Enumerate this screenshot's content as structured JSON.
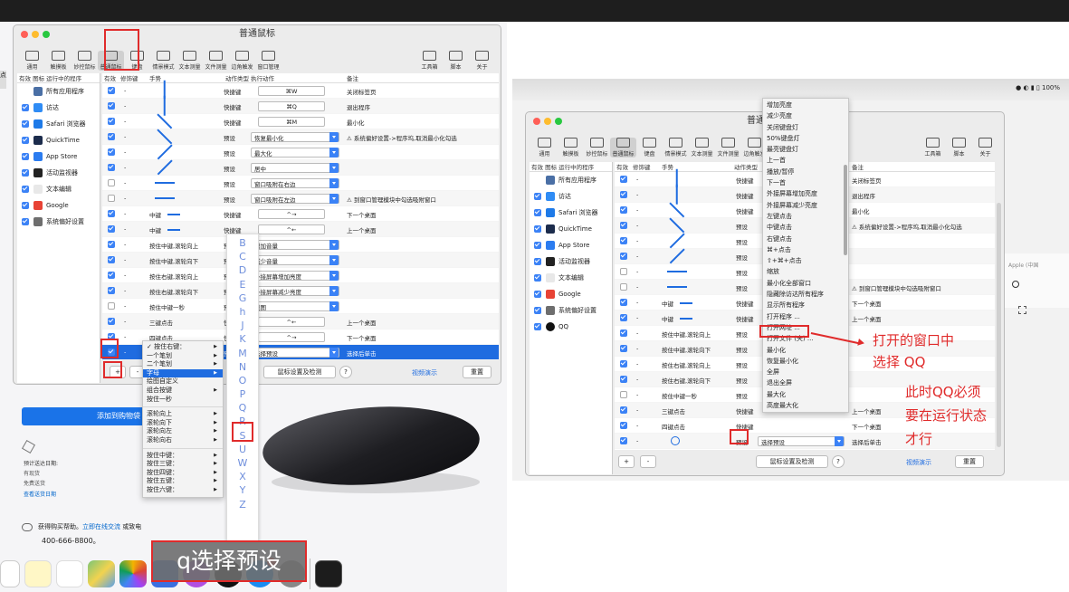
{
  "app": {
    "title": "普通鼠标"
  },
  "toolbar": [
    {
      "label": "通用",
      "icon": "monitor-icon"
    },
    {
      "label": "触摸板",
      "icon": "trackpad-icon"
    },
    {
      "label": "妙控鼠标",
      "icon": "magic-mouse-icon"
    },
    {
      "label": "普通鼠标",
      "icon": "mouse-icon"
    },
    {
      "label": "键盘",
      "icon": "keyboard-icon"
    },
    {
      "label": "情景模式",
      "icon": "sliders-icon"
    },
    {
      "label": "文本测量",
      "icon": "text-measure-icon"
    },
    {
      "label": "文件测量",
      "icon": "file-measure-icon"
    },
    {
      "label": "边角触发",
      "icon": "corner-icon"
    },
    {
      "label": "窗口管理",
      "icon": "window-icon"
    }
  ],
  "toolbar_right": [
    {
      "label": "工具箱",
      "icon": "toolbox-icon"
    },
    {
      "label": "脚本",
      "icon": "script-icon"
    },
    {
      "label": "关于",
      "icon": "info-icon"
    }
  ],
  "sidebar": {
    "headers": [
      "有效",
      "图标",
      "运行中的程序"
    ],
    "items": [
      {
        "label": "所有应用程序",
        "checked": null,
        "color": "#4a6fa5"
      },
      {
        "label": "访达",
        "checked": true,
        "color": "#2f8cf5"
      },
      {
        "label": "Safari 浏览器",
        "checked": true,
        "color": "#1e7ae8"
      },
      {
        "label": "QuickTime",
        "checked": true,
        "color": "#1c2c4c"
      },
      {
        "label": "App Store",
        "checked": true,
        "color": "#2b7cf0"
      },
      {
        "label": "活动监视器",
        "checked": true,
        "color": "#222222"
      },
      {
        "label": "文本编辑",
        "checked": true,
        "color": "#e8e8e8"
      },
      {
        "label": "Google",
        "checked": true,
        "color": "#e84335"
      },
      {
        "label": "系统偏好设置",
        "checked": true,
        "color": "#6e6e6e"
      }
    ]
  },
  "sidebar_right_extra": {
    "label": "QQ",
    "checked": true
  },
  "table": {
    "headers": [
      "有效",
      "修饰键",
      "手势",
      "动作类型",
      "执行动作",
      "备注"
    ],
    "rows": [
      {
        "checked": true,
        "mod": "-",
        "gesture": "",
        "type": "快捷键",
        "action": "⌘W",
        "note": "关闭标签页",
        "dd": false
      },
      {
        "checked": true,
        "mod": "-",
        "gesture": "",
        "type": "快捷键",
        "action": "⌘Q",
        "note": "退出程序",
        "dd": false
      },
      {
        "checked": true,
        "mod": "-",
        "gesture": "",
        "type": "快捷键",
        "action": "⌘M",
        "note": "最小化",
        "dd": false
      },
      {
        "checked": true,
        "mod": "-",
        "gesture": "",
        "type": "预设",
        "action": "恢复最小化",
        "note": "⚠ 系统偏好设置->程序坞,取消最小化勾选",
        "dd": true
      },
      {
        "checked": true,
        "mod": "-",
        "gesture": "",
        "type": "预设",
        "action": "最大化",
        "note": "",
        "dd": true
      },
      {
        "checked": true,
        "mod": "-",
        "gesture": "",
        "type": "预设",
        "action": "居中",
        "note": "",
        "dd": true
      },
      {
        "checked": false,
        "mod": "-",
        "gesture": "",
        "type": "预设",
        "action": "窗口吸附在右边",
        "note": "",
        "dd": true
      },
      {
        "checked": false,
        "mod": "-",
        "gesture": "",
        "type": "预设",
        "action": "窗口吸附在左边",
        "note": "⚠ 到窗口管理模块中勾选吸附窗口",
        "dd": true
      },
      {
        "checked": true,
        "mod": "-",
        "gesture": "中键",
        "type": "快捷键",
        "action": "^→",
        "note": "下一个桌面",
        "dd": false
      },
      {
        "checked": true,
        "mod": "-",
        "gesture": "中键",
        "type": "快捷键",
        "action": "^←",
        "note": "上一个桌面",
        "dd": false
      },
      {
        "checked": true,
        "mod": "-",
        "gesture": "按住中键,滚轮向上",
        "type": "预设",
        "action": "增加音量",
        "note": "",
        "dd": true
      },
      {
        "checked": true,
        "mod": "-",
        "gesture": "按住中键,滚轮向下",
        "type": "预设",
        "action": "减少音量",
        "note": "",
        "dd": true
      },
      {
        "checked": true,
        "mod": "-",
        "gesture": "按住右键,滚轮向上",
        "type": "预设",
        "action": "外接屏幕增加亮度",
        "note": "",
        "dd": true
      },
      {
        "checked": true,
        "mod": "-",
        "gesture": "按住右键,滚轮向下",
        "type": "预设",
        "action": "外接屏幕减少亮度",
        "note": "",
        "dd": true
      },
      {
        "checked": false,
        "mod": "-",
        "gesture": "按住中键一秒",
        "type": "预设",
        "action": "截图",
        "note": "",
        "dd": true
      },
      {
        "checked": true,
        "mod": "-",
        "gesture": "三键点击",
        "type": "快捷键",
        "action": "^←",
        "note": "上一个桌面",
        "dd": false
      },
      {
        "checked": true,
        "mod": "-",
        "gesture": "四键点击",
        "type": "快捷键",
        "action": "^→",
        "note": "下一个桌面",
        "dd": false
      },
      {
        "checked": true,
        "mod": "-",
        "gesture": "",
        "type": "预设",
        "action": "选择预设",
        "note": "选择后单击",
        "dd": true
      }
    ]
  },
  "bottom": {
    "add": "+",
    "remove": "-",
    "settings": "鼠标设置及检测",
    "help": "?",
    "video": "视频演示",
    "reset": "重置"
  },
  "gesture_menu": {
    "items": [
      {
        "label": "✓ 按住右键：",
        "sub": true
      },
      {
        "label": "一个笔划",
        "sub": true
      },
      {
        "label": "二个笔划",
        "sub": true
      },
      {
        "label": "字母",
        "sub": true,
        "hl": true
      },
      {
        "label": "绘图自定义",
        "sub": false
      },
      {
        "label": "组合按键",
        "sub": true
      },
      {
        "label": "按住一秒",
        "sub": false
      },
      {
        "sep": true
      },
      {
        "label": "滚轮向上",
        "sub": true
      },
      {
        "label": "滚轮向下",
        "sub": true
      },
      {
        "label": "滚轮向左",
        "sub": true
      },
      {
        "label": "滚轮向右",
        "sub": true
      },
      {
        "sep": true
      },
      {
        "label": "按住中键：",
        "sub": true
      },
      {
        "label": "按住三键：",
        "sub": true
      },
      {
        "label": "按住四键：",
        "sub": true
      },
      {
        "label": "按住五键：",
        "sub": true
      },
      {
        "label": "按住六键：",
        "sub": true
      }
    ]
  },
  "letters": [
    "B",
    "C",
    "D",
    "E",
    "G",
    "h",
    "J",
    "K",
    "M",
    "N",
    "O",
    "P",
    "Q",
    "R",
    "S",
    "U",
    "W",
    "X",
    "Y",
    "Z"
  ],
  "store": {
    "add_to_bag": "添加到购物袋",
    "delivery_date": "预计送达日期:",
    "in_stock": "有现货",
    "free_ship": "免费送货",
    "check_date": "查看送货日期",
    "help_text": "获得购买帮助。",
    "chat_link": "立即在线交流",
    "or_call": "或致电",
    "phone": "400-666-8800。"
  },
  "caption_left": "q选择预设",
  "action_menu": {
    "items": [
      "增加亮度",
      "减少亮度",
      "关闭键盘灯",
      "50%键盘灯",
      "最亮键盘灯",
      "上一首",
      "播放/暂停",
      "下一首",
      "外接屏幕增加亮度",
      "外接屏幕减少亮度",
      "左键点击",
      "中键点击",
      "右键点击",
      "⌘+点击",
      "⇧+⌘+点击",
      "缩放",
      "最小化全部窗口",
      "隐藏除访达所有程序",
      "显示所有程序",
      "打开程序 ...",
      "打开网址 ...",
      "打开文件 (夹) ...",
      "最小化",
      "恢复最小化",
      "全屏",
      "退出全屏",
      "最大化",
      "高度最大化"
    ],
    "highlight": "打开程序 ..."
  },
  "annotations": {
    "open_window": "打开的窗口中\n选择 QQ",
    "qq_running": "此时QQ必须\n要在运行状态\n才行"
  },
  "right_status": "100%",
  "right_misc": {
    "apple_text": "Apple (中国"
  }
}
